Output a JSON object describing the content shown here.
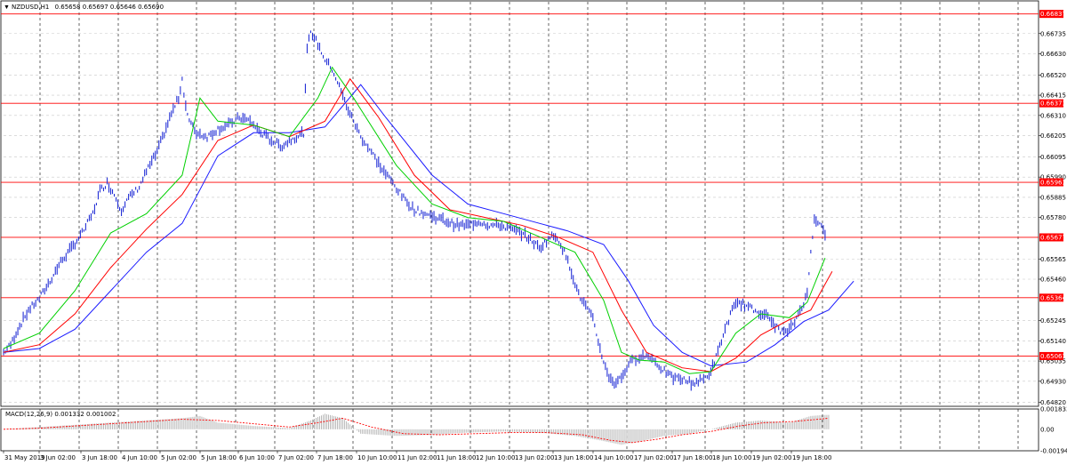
{
  "symbol_header": {
    "symbol": "NZDUSD,H1",
    "ohlc": "0.65658 0.65697 0.65646 0.65690"
  },
  "macd_header": "MACD(12,26,9) 0.001332 0.001002",
  "colors": {
    "candle": "#2430d6",
    "ma_fast": "#00d000",
    "ma_mid": "#ff0000",
    "ma_slow": "#1a1aff",
    "level_line": "#ff0000",
    "label_bg": "#ff0000",
    "grid": "#c8c8c8",
    "macd_hist": "#b0b0b0",
    "macd_signal": "#ff0000",
    "axis_text": "#000000"
  },
  "chart_data": {
    "type": "line",
    "title": "NZDUSD,H1",
    "ylim": [
      0.648,
      0.669
    ],
    "y_ticks": [
      "0.66735",
      "0.66630",
      "0.66520",
      "0.66415",
      "0.66310",
      "0.66205",
      "0.66095",
      "0.65990",
      "0.65885",
      "0.65780",
      "0.65565",
      "0.65460",
      "0.65245",
      "0.65140",
      "0.65035",
      "0.64930",
      "0.64820"
    ],
    "horizontal_levels": [
      "0.66837",
      "0.66373",
      "0.65963",
      "0.65677",
      "0.65364",
      "0.65061"
    ],
    "x_labels": [
      "31 May 2019",
      "3 Jun 02:00",
      "3 Jun 18:00",
      "4 Jun 10:00",
      "5 Jun 02:00",
      "5 Jun 18:00",
      "6 Jun 10:00",
      "7 Jun 02:00",
      "7 Jun 18:00",
      "10 Jun 10:00",
      "11 Jun 02:00",
      "11 Jun 18:00",
      "12 Jun 10:00",
      "13 Jun 02:00",
      "13 Jun 18:00",
      "14 Jun 10:00",
      "17 Jun 02:00",
      "17 Jun 18:00",
      "18 Jun 10:00",
      "19 Jun 02:00",
      "19 Jun 18:00"
    ],
    "price_path": [
      [
        0,
        0.6508
      ],
      [
        4,
        0.6512
      ],
      [
        8,
        0.652
      ],
      [
        14,
        0.653
      ],
      [
        20,
        0.6536
      ],
      [
        26,
        0.6545
      ],
      [
        32,
        0.6555
      ],
      [
        38,
        0.6562
      ],
      [
        44,
        0.657
      ],
      [
        50,
        0.658
      ],
      [
        54,
        0.6592
      ],
      [
        58,
        0.6596
      ],
      [
        62,
        0.659
      ],
      [
        66,
        0.6582
      ],
      [
        70,
        0.6588
      ],
      [
        76,
        0.6594
      ],
      [
        80,
        0.6602
      ],
      [
        86,
        0.6612
      ],
      [
        90,
        0.6622
      ],
      [
        94,
        0.6632
      ],
      [
        98,
        0.664
      ],
      [
        100,
        0.665
      ],
      [
        102,
        0.6636
      ],
      [
        104,
        0.6628
      ],
      [
        108,
        0.6622
      ],
      [
        114,
        0.662
      ],
      [
        120,
        0.6624
      ],
      [
        126,
        0.6626
      ],
      [
        132,
        0.663
      ],
      [
        138,
        0.6628
      ],
      [
        144,
        0.6622
      ],
      [
        150,
        0.6618
      ],
      [
        156,
        0.6615
      ],
      [
        160,
        0.6618
      ],
      [
        164,
        0.662
      ],
      [
        168,
        0.6622
      ],
      [
        170,
        0.6665
      ],
      [
        172,
        0.6675
      ],
      [
        176,
        0.6668
      ],
      [
        180,
        0.666
      ],
      [
        184,
        0.6655
      ],
      [
        188,
        0.6646
      ],
      [
        192,
        0.6636
      ],
      [
        196,
        0.6628
      ],
      [
        200,
        0.662
      ],
      [
        206,
        0.6612
      ],
      [
        212,
        0.6603
      ],
      [
        218,
        0.6596
      ],
      [
        224,
        0.6588
      ],
      [
        230,
        0.6582
      ],
      [
        236,
        0.658
      ],
      [
        242,
        0.6578
      ],
      [
        248,
        0.6576
      ],
      [
        254,
        0.6574
      ],
      [
        260,
        0.6574
      ],
      [
        266,
        0.6576
      ],
      [
        272,
        0.6574
      ],
      [
        278,
        0.6574
      ],
      [
        284,
        0.6572
      ],
      [
        290,
        0.657
      ],
      [
        296,
        0.6566
      ],
      [
        300,
        0.6562
      ],
      [
        306,
        0.6568
      ],
      [
        310,
        0.6568
      ],
      [
        314,
        0.656
      ],
      [
        318,
        0.655
      ],
      [
        322,
        0.6538
      ],
      [
        326,
        0.6532
      ],
      [
        330,
        0.6525
      ],
      [
        334,
        0.651
      ],
      [
        338,
        0.6497
      ],
      [
        342,
        0.6492
      ],
      [
        346,
        0.6495
      ],
      [
        350,
        0.6502
      ],
      [
        356,
        0.6506
      ],
      [
        362,
        0.6506
      ],
      [
        368,
        0.65
      ],
      [
        374,
        0.6495
      ],
      [
        380,
        0.6494
      ],
      [
        386,
        0.6492
      ],
      [
        392,
        0.6494
      ],
      [
        396,
        0.6498
      ],
      [
        400,
        0.6508
      ],
      [
        404,
        0.652
      ],
      [
        408,
        0.653
      ],
      [
        412,
        0.6534
      ],
      [
        416,
        0.6532
      ],
      [
        420,
        0.653
      ],
      [
        426,
        0.6528
      ],
      [
        430,
        0.6524
      ],
      [
        434,
        0.652
      ],
      [
        438,
        0.6518
      ],
      [
        442,
        0.6522
      ],
      [
        446,
        0.653
      ],
      [
        450,
        0.6538
      ],
      [
        452,
        0.656
      ],
      [
        454,
        0.6578
      ],
      [
        456,
        0.6576
      ],
      [
        460,
        0.657
      ]
    ],
    "ma_fast": [
      [
        0,
        0.651
      ],
      [
        20,
        0.6518
      ],
      [
        40,
        0.654
      ],
      [
        60,
        0.657
      ],
      [
        80,
        0.658
      ],
      [
        100,
        0.66
      ],
      [
        110,
        0.664
      ],
      [
        120,
        0.6628
      ],
      [
        140,
        0.6626
      ],
      [
        160,
        0.662
      ],
      [
        176,
        0.664
      ],
      [
        184,
        0.6656
      ],
      [
        196,
        0.664
      ],
      [
        220,
        0.6605
      ],
      [
        240,
        0.6585
      ],
      [
        260,
        0.6578
      ],
      [
        280,
        0.6576
      ],
      [
        300,
        0.6568
      ],
      [
        320,
        0.656
      ],
      [
        336,
        0.6535
      ],
      [
        346,
        0.6508
      ],
      [
        356,
        0.6504
      ],
      [
        370,
        0.6503
      ],
      [
        384,
        0.6497
      ],
      [
        396,
        0.6498
      ],
      [
        410,
        0.6518
      ],
      [
        424,
        0.6528
      ],
      [
        440,
        0.6526
      ],
      [
        450,
        0.6534
      ],
      [
        460,
        0.6557
      ]
    ],
    "ma_mid": [
      [
        0,
        0.6508
      ],
      [
        20,
        0.6512
      ],
      [
        40,
        0.6528
      ],
      [
        60,
        0.6552
      ],
      [
        80,
        0.6572
      ],
      [
        100,
        0.659
      ],
      [
        120,
        0.6618
      ],
      [
        140,
        0.6626
      ],
      [
        160,
        0.662
      ],
      [
        180,
        0.6628
      ],
      [
        194,
        0.665
      ],
      [
        210,
        0.663
      ],
      [
        230,
        0.66
      ],
      [
        250,
        0.6582
      ],
      [
        270,
        0.6578
      ],
      [
        290,
        0.6574
      ],
      [
        310,
        0.6568
      ],
      [
        330,
        0.656
      ],
      [
        346,
        0.653
      ],
      [
        360,
        0.6508
      ],
      [
        380,
        0.65
      ],
      [
        396,
        0.6498
      ],
      [
        410,
        0.6505
      ],
      [
        424,
        0.6517
      ],
      [
        440,
        0.6525
      ],
      [
        452,
        0.653
      ],
      [
        464,
        0.655
      ]
    ],
    "ma_slow": [
      [
        0,
        0.6508
      ],
      [
        20,
        0.651
      ],
      [
        40,
        0.652
      ],
      [
        60,
        0.654
      ],
      [
        80,
        0.656
      ],
      [
        100,
        0.6575
      ],
      [
        120,
        0.661
      ],
      [
        140,
        0.6622
      ],
      [
        160,
        0.6622
      ],
      [
        180,
        0.6625
      ],
      [
        200,
        0.6647
      ],
      [
        214,
        0.663
      ],
      [
        240,
        0.66
      ],
      [
        260,
        0.6585
      ],
      [
        280,
        0.658
      ],
      [
        300,
        0.6575
      ],
      [
        316,
        0.6571
      ],
      [
        336,
        0.6564
      ],
      [
        350,
        0.6545
      ],
      [
        364,
        0.6522
      ],
      [
        380,
        0.6508
      ],
      [
        396,
        0.6501
      ],
      [
        416,
        0.6503
      ],
      [
        432,
        0.6512
      ],
      [
        448,
        0.6524
      ],
      [
        462,
        0.653
      ],
      [
        476,
        0.6545
      ]
    ],
    "macd": {
      "ylim": [
        -0.001942,
        0.001833
      ],
      "y_ticks": [
        "0.001833",
        "0.00",
        "-0.001942"
      ],
      "histogram": [
        [
          0,
          0.0
        ],
        [
          20,
          0.0002
        ],
        [
          40,
          0.0004
        ],
        [
          60,
          0.0006
        ],
        [
          80,
          0.0008
        ],
        [
          100,
          0.001
        ],
        [
          110,
          0.0012
        ],
        [
          120,
          0.0006
        ],
        [
          140,
          0.0003
        ],
        [
          160,
          0.0001
        ],
        [
          172,
          0.0008
        ],
        [
          180,
          0.0014
        ],
        [
          190,
          0.001
        ],
        [
          200,
          -0.0004
        ],
        [
          220,
          -0.0006
        ],
        [
          240,
          -0.0005
        ],
        [
          260,
          -0.0003
        ],
        [
          280,
          -0.0002
        ],
        [
          300,
          -0.0003
        ],
        [
          320,
          -0.0006
        ],
        [
          334,
          -0.001
        ],
        [
          346,
          -0.0014
        ],
        [
          356,
          -0.0011
        ],
        [
          370,
          -0.0006
        ],
        [
          384,
          -0.0004
        ],
        [
          396,
          0.0
        ],
        [
          410,
          0.0006
        ],
        [
          424,
          0.0008
        ],
        [
          440,
          0.0006
        ],
        [
          452,
          0.0012
        ],
        [
          460,
          0.0013
        ]
      ],
      "signal": [
        [
          0,
          0.0
        ],
        [
          20,
          0.0001
        ],
        [
          40,
          0.0003
        ],
        [
          60,
          0.0005
        ],
        [
          80,
          0.0007
        ],
        [
          100,
          0.0009
        ],
        [
          120,
          0.0008
        ],
        [
          140,
          0.0005
        ],
        [
          160,
          0.0002
        ],
        [
          176,
          0.0006
        ],
        [
          190,
          0.001
        ],
        [
          206,
          0.0002
        ],
        [
          224,
          -0.0004
        ],
        [
          244,
          -0.0005
        ],
        [
          264,
          -0.0004
        ],
        [
          284,
          -0.0003
        ],
        [
          304,
          -0.0003
        ],
        [
          324,
          -0.0005
        ],
        [
          340,
          -0.001
        ],
        [
          352,
          -0.0012
        ],
        [
          366,
          -0.0009
        ],
        [
          380,
          -0.0005
        ],
        [
          396,
          -0.0002
        ],
        [
          412,
          0.0003
        ],
        [
          426,
          0.0006
        ],
        [
          442,
          0.0007
        ],
        [
          456,
          0.0009
        ],
        [
          462,
          0.001
        ]
      ]
    }
  }
}
